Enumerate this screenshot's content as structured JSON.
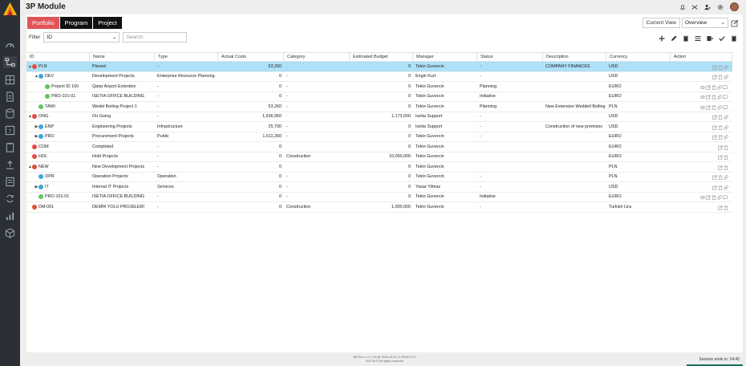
{
  "app": {
    "title": "3P Module"
  },
  "tabs": [
    {
      "label": "Portfolio"
    },
    {
      "label": "Program"
    },
    {
      "label": "Project"
    }
  ],
  "view": {
    "label": "Current View",
    "selected": "Overview"
  },
  "filter": {
    "label": "Filter",
    "field": "ID",
    "search_placeholder": "Search"
  },
  "columns": [
    "ID",
    "Name",
    "Type",
    "Actual Costs",
    "Category",
    "Estimated Budget",
    "Manager",
    "Status",
    "Description",
    "Currency",
    "Action"
  ],
  "rows": [
    {
      "caret": "▲",
      "dot": "red",
      "indent": 0,
      "id": "PLN",
      "name": "Planed",
      "type": "-",
      "cost": "53,260",
      "category": "",
      "budget": "0",
      "manager": "Tekin Guvercin",
      "status": "-",
      "description": "COMPANY FINANCES",
      "currency": "USD",
      "selected": true,
      "actions": 3
    },
    {
      "caret": "▲",
      "dot": "blue",
      "indent": 1,
      "id": "DEV",
      "name": "Development Projects",
      "type": "Enterprise Resource Planning",
      "cost": "0",
      "category": "-",
      "budget": "0",
      "manager": "Engin Kurt",
      "status": "-",
      "description": "",
      "currency": "USD",
      "selected": false,
      "actions": 3
    },
    {
      "caret": "",
      "dot": "green",
      "indent": 2,
      "id": "Project ID 100",
      "name": "Qatar Airport Extention",
      "type": "-",
      "cost": "0",
      "category": "-",
      "budget": "0",
      "manager": "Tekin Guvercin",
      "status": "Planning",
      "description": "",
      "currency": "EURO",
      "selected": false,
      "actions": 5
    },
    {
      "caret": "",
      "dot": "green",
      "indent": 2,
      "id": "PRO-101-01",
      "name": "ISETIA OFFICE BUILDING",
      "type": "-",
      "cost": "0",
      "category": "-",
      "budget": "0",
      "manager": "Tekin Guvercin",
      "status": "Initiative",
      "description": "",
      "currency": "EURO",
      "selected": false,
      "actions": 5
    },
    {
      "caret": "",
      "dot": "green",
      "indent": 1,
      "id": "TAWI",
      "name": "Wedel Boiling Project 1",
      "type": "-",
      "cost": "53,260",
      "category": "-",
      "budget": "0",
      "manager": "Tekin Guvercin",
      "status": "Planning",
      "description": "New Extension Weddell Boiling",
      "currency": "PLN",
      "selected": false,
      "actions": 5
    },
    {
      "caret": "▲",
      "dot": "red",
      "indent": 0,
      "id": "ONG",
      "name": "On Going",
      "type": "-",
      "cost": "1,636,960",
      "category": "",
      "budget": "1,173,000",
      "manager": "Isetia Support",
      "status": "-",
      "description": "",
      "currency": "USD",
      "selected": false,
      "actions": 3
    },
    {
      "caret": "▶",
      "dot": "blue",
      "indent": 1,
      "id": "ENP",
      "name": "Engineering Projects",
      "type": "Infrastructure",
      "cost": "25,700",
      "category": "-",
      "budget": "0",
      "manager": "Isetia Support",
      "status": "-",
      "description": "Construction of new premises",
      "currency": "USD",
      "selected": false,
      "actions": 3
    },
    {
      "caret": "▶",
      "dot": "blue",
      "indent": 1,
      "id": "PRO",
      "name": "Procurement Projects",
      "type": "Public",
      "cost": "1,611,260",
      "category": "-",
      "budget": "0",
      "manager": "Tekin Guvercin",
      "status": "-",
      "description": "",
      "currency": "EURO",
      "selected": false,
      "actions": 3
    },
    {
      "caret": "",
      "dot": "red",
      "indent": 0,
      "id": "COM",
      "name": "Completed",
      "type": "-",
      "cost": "0",
      "category": "",
      "budget": "0",
      "manager": "Tekin Guvercin",
      "status": "",
      "description": "",
      "currency": "EURO",
      "selected": false,
      "actions": 2
    },
    {
      "caret": "",
      "dot": "red",
      "indent": 0,
      "id": "HOL",
      "name": "Hold Projects",
      "type": "-",
      "cost": "0",
      "category": "Construction",
      "budget": "10,000,000",
      "manager": "Tekin Guvercin",
      "status": "",
      "description": "",
      "currency": "EURO",
      "selected": false,
      "actions": 2
    },
    {
      "caret": "▲",
      "dot": "red",
      "indent": 0,
      "id": "NEW",
      "name": "New Development Projects",
      "type": "-",
      "cost": "0",
      "category": "",
      "budget": "0",
      "manager": "Tekin Guvercin",
      "status": "",
      "description": "",
      "currency": "PLN",
      "selected": false,
      "actions": 2
    },
    {
      "caret": "",
      "dot": "blue",
      "indent": 1,
      "id": "OPR",
      "name": "Operation Projects",
      "type": "Operation",
      "cost": "0",
      "category": "-",
      "budget": "0",
      "manager": "Tekin Guvercin",
      "status": "-",
      "description": "",
      "currency": "PLN",
      "selected": false,
      "actions": 3
    },
    {
      "caret": "▶",
      "dot": "blue",
      "indent": 1,
      "id": "IT",
      "name": "Internal IT Projects",
      "type": "Services",
      "cost": "0",
      "category": "-",
      "budget": "0",
      "manager": "Yasar Yilmaz",
      "status": "-",
      "description": "",
      "currency": "USD",
      "selected": false,
      "actions": 3
    },
    {
      "caret": "",
      "dot": "green",
      "indent": 1,
      "id": "PRO-101-01",
      "name": "ISETIA OFFICE BUILDING",
      "type": "-",
      "cost": "0",
      "category": "-",
      "budget": "0",
      "manager": "Tekin Guvercin",
      "status": "Initiative",
      "description": "",
      "currency": "EURO",
      "selected": false,
      "actions": 5
    },
    {
      "caret": "",
      "dot": "red",
      "indent": 0,
      "id": "DM-001",
      "name": "DEMİR YOLU PROJELERİ",
      "type": "-",
      "cost": "0",
      "category": "Construction",
      "budget": "1,000,000",
      "manager": "Tekin Guvercin",
      "status": "-",
      "description": "",
      "currency": "Turkish Lira",
      "selected": false,
      "actions": 2
    }
  ],
  "footer": {
    "version": "ISETIA v 1.1.7.29 @ 2024-10-01 11:39:00 UTC",
    "rights": "ISETIA ® All rights reserved",
    "session": "Session ends in: 24:45"
  },
  "colors": {
    "active_tab": "#e05457",
    "selected_row": "#aee0f7",
    "sidebar": "#2b2f36"
  }
}
